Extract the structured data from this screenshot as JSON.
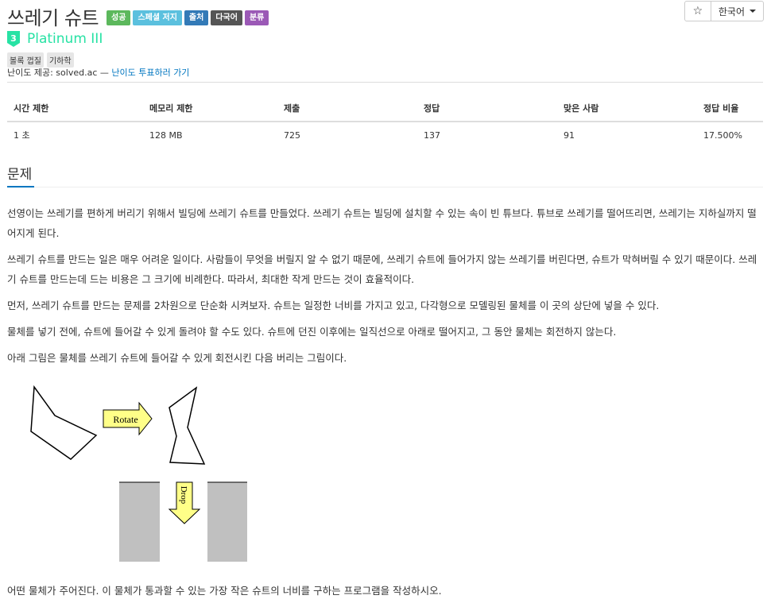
{
  "problem": {
    "title": "쓰레기 슈트",
    "labels": [
      {
        "text": "성공",
        "color": "#5cb85c"
      },
      {
        "text": "스페셜 저지",
        "color": "#5bc0de"
      },
      {
        "text": "출처",
        "color": "#337ab7"
      },
      {
        "text": "다국어",
        "color": "#555555"
      },
      {
        "text": "분류",
        "color": "#9b59b6"
      }
    ],
    "tier": {
      "level": "3",
      "name": "Platinum III",
      "color": "#27e2a4"
    },
    "tags": [
      "볼록 껍질",
      "기하학"
    ],
    "source": {
      "prefix": "난이도 제공: solved.ac — ",
      "link": "난이도 투표하러 가기"
    }
  },
  "toolbar": {
    "star_icon": "☆",
    "language": "한국어"
  },
  "stats": {
    "headers": [
      "시간 제한",
      "메모리 제한",
      "제출",
      "정답",
      "맞은 사람",
      "정답 비율"
    ],
    "values": [
      "1 초",
      "128 MB",
      "725",
      "137",
      "91",
      "17.500%"
    ]
  },
  "section": {
    "title": "문제"
  },
  "description": [
    "선영이는 쓰레기를 편하게 버리기 위해서 빌딩에 쓰레기 슈트를 만들었다. 쓰레기 슈트는 빌딩에 설치할 수 있는 속이 빈 튜브다. 튜브로 쓰레기를 떨어뜨리면, 쓰레기는 지하실까지 떨어지게 된다.",
    "쓰레기 슈트를 만드는 일은 매우 어려운 일이다. 사람들이 무엇을 버릴지 알 수 없기 때문에, 쓰레기 슈트에 들어가지 않는 쓰레기를 버린다면, 슈트가 막혀버릴 수 있기 때문이다. 쓰레기 슈트를 만드는데 드는 비용은 그 크기에 비례한다. 따라서, 최대한 작게 만드는 것이 효율적이다.",
    "먼저, 쓰레기 슈트를 만드는 문제를 2차원으로 단순화 시켜보자. 슈트는 일정한 너비를 가지고 있고, 다각형으로 모델링된 물체를 이 곳의 상단에 넣을 수 있다.",
    "물체를 넣기 전에, 슈트에 들어갈 수 있게 돌려야 할 수도 있다. 슈트에 던진 이후에는 일직선으로 아래로 떨어지고, 그 동안 물체는 회전하지 않는다.",
    "아래 그림은 물체를 쓰레기 슈트에 들어갈 수 있게 회전시킨 다음 버리는 그림이다."
  ],
  "figure": {
    "rotate_label": "Rotate",
    "drop_label": "Drop",
    "arrow_color": "#ffff88",
    "chute_color": "#c0c0c0"
  },
  "last_paragraph": "어떤 물체가 주어진다. 이 물체가 통과할 수 있는 가장 작은 슈트의 너비를 구하는 프로그램을 작성하시오."
}
